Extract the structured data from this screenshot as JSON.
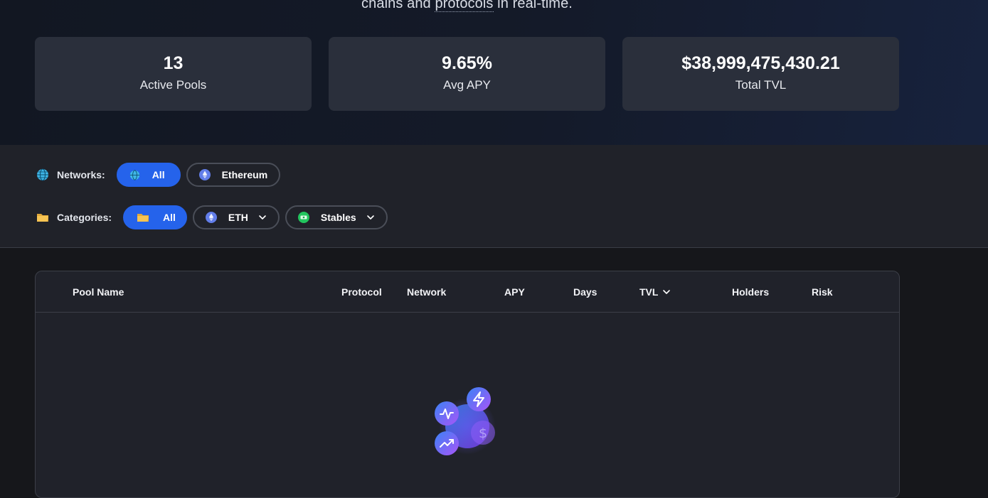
{
  "hero": {
    "text_before": "chains and ",
    "text_link": "protocols",
    "text_after": " in real-time."
  },
  "stats": [
    {
      "value": "13",
      "label": "Active Pools"
    },
    {
      "value": "9.65%",
      "label": "Avg APY"
    },
    {
      "value": "$38,999,475,430.21",
      "label": "Total TVL"
    }
  ],
  "filters": {
    "networks": {
      "label": "Networks:",
      "icon": "globe-icon",
      "options": [
        {
          "label": "All",
          "icon": "globe-icon",
          "active": true
        },
        {
          "label": "Ethereum",
          "icon": "ethereum-icon",
          "active": false
        }
      ]
    },
    "categories": {
      "label": "Categories:",
      "icon": "folder-icon",
      "options": [
        {
          "label": "All",
          "icon": "folder-icon",
          "active": true
        },
        {
          "label": "ETH",
          "icon": "ethereum-icon",
          "active": false,
          "dropdown": true
        },
        {
          "label": "Stables",
          "icon": "cash-icon",
          "active": false,
          "dropdown": true
        }
      ]
    }
  },
  "table": {
    "columns": [
      "Pool Name",
      "Protocol",
      "Network",
      "APY",
      "Days",
      "TVL",
      "Holders",
      "Risk"
    ],
    "sorted_column": "TVL",
    "loading_icons": [
      "activity-icon",
      "bolt-icon",
      "dollar-icon",
      "trending-up-icon"
    ]
  },
  "colors": {
    "accent": "#2563eb",
    "card_bg": "#2a2f3b",
    "panel_bg": "#202229",
    "loader_gradient_start": "#3b82f6",
    "loader_gradient_end": "#a855f7"
  }
}
